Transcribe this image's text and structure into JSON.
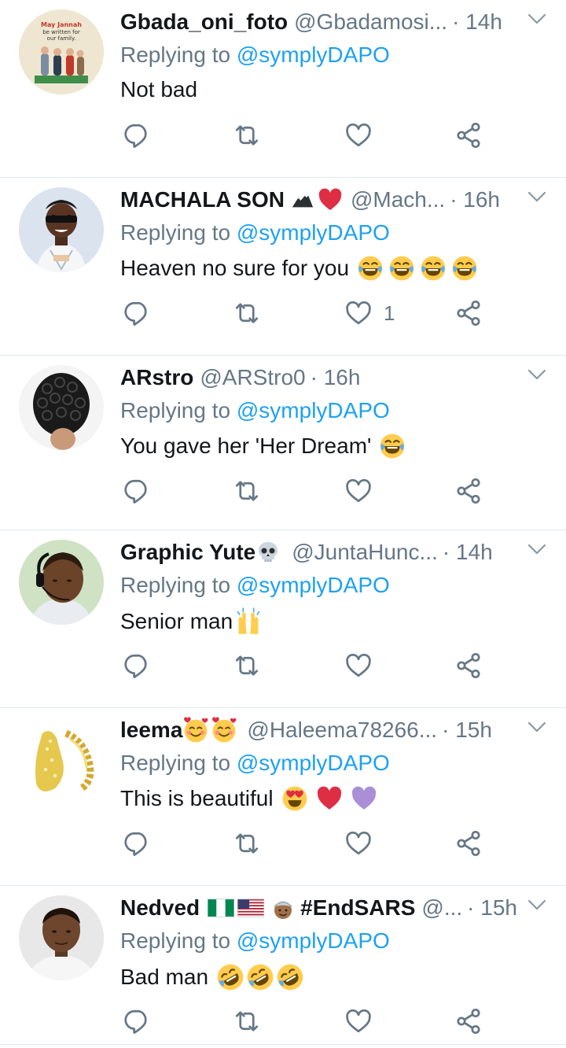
{
  "replies": [
    {
      "name": "Gbada_oni_foto",
      "handle": "@Gbadamosi...",
      "time": "· 14h",
      "replying_prefix": "Replying to",
      "replying_to": "@symplyDAPO",
      "text": "Not bad",
      "like_count": "",
      "avatar_text": [
        "May Jannah",
        "be written for",
        "our family."
      ]
    },
    {
      "name": "MACHALA SON",
      "handle": "@Mach...",
      "time": "· 16h",
      "replying_prefix": "Replying to",
      "replying_to": "@symplyDAPO",
      "text": "Heaven no sure for you",
      "like_count": "1"
    },
    {
      "name": "ARstro",
      "handle": "@ARStro0",
      "time": "· 16h",
      "replying_prefix": "Replying to",
      "replying_to": "@symplyDAPO",
      "text": "You gave her 'Her Dream'",
      "like_count": ""
    },
    {
      "name": "Graphic Yute",
      "handle": "@JuntaHunc...",
      "time": "· 14h",
      "replying_prefix": "Replying to",
      "replying_to": "@symplyDAPO",
      "text": "Senior man",
      "like_count": ""
    },
    {
      "name": "leema",
      "handle": "@Haleema78266...",
      "time": "· 15h",
      "replying_prefix": "Replying to",
      "replying_to": "@symplyDAPO",
      "text": "This is beautiful",
      "like_count": ""
    },
    {
      "name": "Nedved",
      "name_suffix": "#EndSARS",
      "handle": "@...",
      "time": "· 15h",
      "replying_prefix": "Replying to",
      "replying_to": "@symplyDAPO",
      "text": "Bad man",
      "like_count": ""
    }
  ],
  "colors": {
    "text": "#14171a",
    "secondary": "#657786",
    "link": "#1da1f2",
    "divider": "#e1e8ed"
  },
  "icons": [
    "reply-icon",
    "retweet-icon",
    "like-icon",
    "share-icon",
    "caret-down-icon"
  ]
}
